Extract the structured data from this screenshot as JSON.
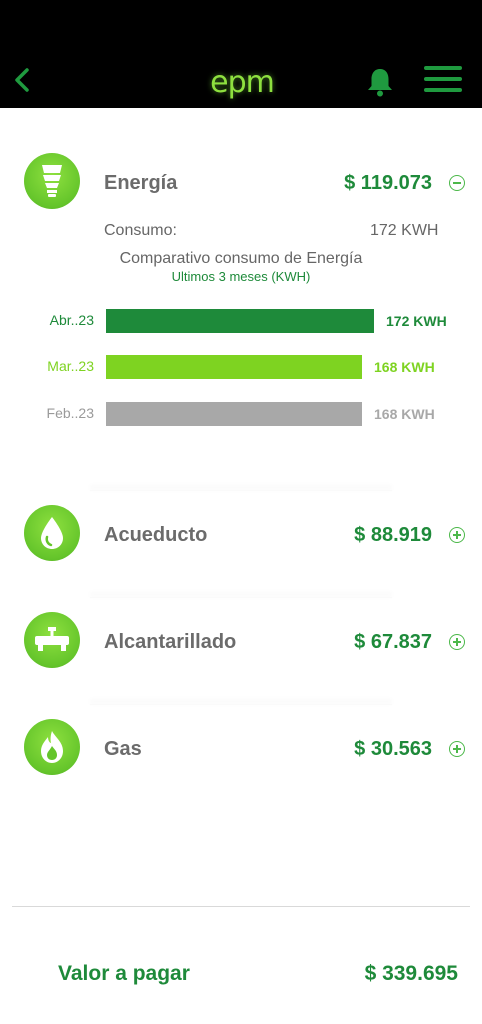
{
  "header": {
    "logo_text": "epm",
    "back_icon": "chevron-left-icon",
    "bell_icon": "bell-icon",
    "menu_icon": "hamburger-menu-icon"
  },
  "colors": {
    "accent_dark": "#1e8a3a",
    "accent_light": "#8ee03f",
    "gray_bar": "#a8a8a8"
  },
  "services": [
    {
      "name": "Energía",
      "amount": "$ 119.073",
      "icon": "lightbulb-icon",
      "expanded": true
    },
    {
      "name": "Acueducto",
      "amount": "$ 88.919",
      "icon": "water-drop-icon",
      "expanded": false
    },
    {
      "name": "Alcantarillado",
      "amount": "$ 67.837",
      "icon": "pipe-icon",
      "expanded": false
    },
    {
      "name": "Gas",
      "amount": "$ 30.563",
      "icon": "flame-icon",
      "expanded": false
    }
  ],
  "energy_detail": {
    "consumo_label": "Consumo:",
    "consumo_value": "172 KWH",
    "comparison_title": "Comparativo consumo de Energía",
    "comparison_subtitle": "Ultimos 3 meses (KWH)"
  },
  "chart_data": {
    "type": "bar",
    "orientation": "horizontal",
    "categories": [
      "Abr..23",
      "Mar..23",
      "Feb..23"
    ],
    "values": [
      172,
      168,
      168
    ],
    "value_labels": [
      "172 KWH",
      "168 KWH",
      "168 KWH"
    ],
    "colors": [
      "#1e8a3a",
      "#7ed321",
      "#a8a8a8"
    ],
    "title": "Comparativo consumo de Energía",
    "subtitle": "Ultimos 3 meses (KWH)"
  },
  "footer": {
    "total_label": "Valor a pagar",
    "total_value": "$ 339.695"
  }
}
